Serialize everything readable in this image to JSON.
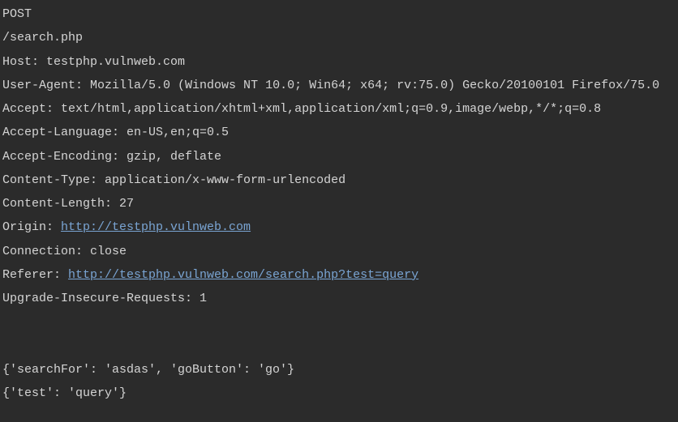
{
  "method": "POST",
  "path": "/search.php",
  "headers": {
    "host_label": "Host: ",
    "host_value": "testphp.vulnweb.com",
    "ua_label": "User-Agent: ",
    "ua_value": "Mozilla/5.0 (Windows NT 10.0; Win64; x64; rv:75.0) Gecko/20100101 Firefox/75.0",
    "accept_label": "Accept: ",
    "accept_value": "text/html,application/xhtml+xml,application/xml;q=0.9,image/webp,*/*;q=0.8",
    "alang_label": "Accept-Language: ",
    "alang_value": "en-US,en;q=0.5",
    "aenc_label": "Accept-Encoding: ",
    "aenc_value": "gzip, deflate",
    "ctype_label": "Content-Type: ",
    "ctype_value": "application/x-www-form-urlencoded",
    "clen_label": "Content-Length: ",
    "clen_value": "27",
    "origin_label": "Origin: ",
    "origin_url": "http://testphp.vulnweb.com",
    "conn_label": "Connection: ",
    "conn_value": "close",
    "ref_label": "Referer: ",
    "ref_url": "http://testphp.vulnweb.com/search.php?test=query",
    "uir_label": "Upgrade-Insecure-Requests: ",
    "uir_value": "1"
  },
  "body": {
    "dict1": "{'searchFor': 'asdas', 'goButton': 'go'}",
    "dict2": "{'test': 'query'}"
  }
}
